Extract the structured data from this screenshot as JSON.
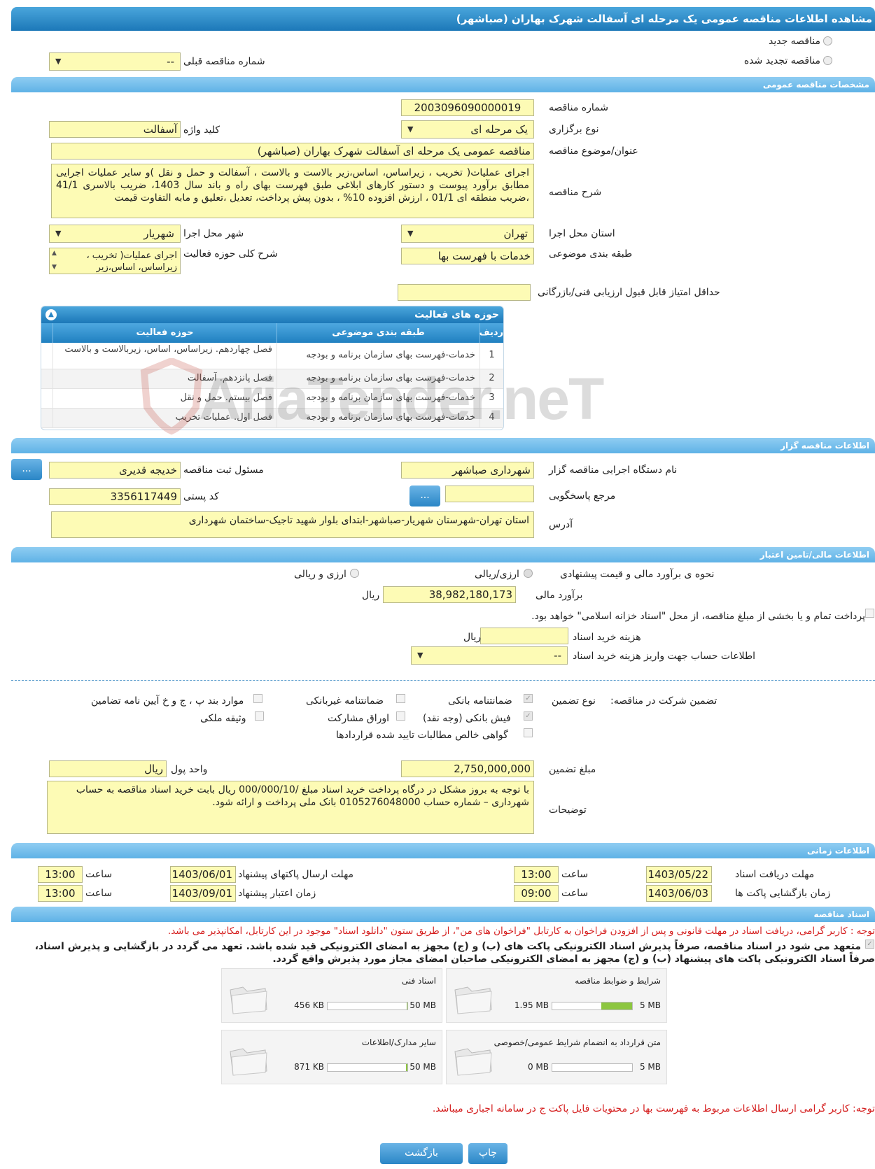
{
  "title": "مشاهده اطلاعات مناقصه عمومی یک مرحله ای آسفالت شهرک بهاران (صباشهر)",
  "top": {
    "new_tender": "مناقصه جدید",
    "renewed_tender": "مناقصه تجدید شده",
    "prev_number_label": "شماره مناقصه قبلی",
    "prev_number_value": "--"
  },
  "general": {
    "section": "مشخصات مناقصه عمومی",
    "tender_number_label": "شماره مناقصه",
    "tender_number": "2003096090000019",
    "type_label": "نوع برگزاری",
    "type_value": "یک مرحله ای",
    "keyword_label": "کلید واژه",
    "keyword_value": "آسفالت",
    "subject_label": "عنوان/موضوع مناقصه",
    "subject_value": "مناقصه عمومی یک مرحله ای آسفالت شهرک بهاران (صباشهر)",
    "desc_label": "شرح مناقصه",
    "desc_value": "اجرای عملیات( تخریب ، زیراساس، اساس،زیر بالاست و بالاست ، آسفالت و حمل و نقل )و سایر عملیات اجرایی مطابق برآورد پیوست و دستور کارهای ابلاغی طبق فهرست بهای راه و باند سال 1403، ضریب بالاسری 41/1 ،ضریب منطقه ای 01/1 ، ارزش افزوده 10% ، بدون پیش پرداخت، تعدیل ،تعلیق و مابه التفاوت قیمت",
    "province_label": "استان محل اجرا",
    "province_value": "تهران",
    "city_label": "شهر محل اجرا",
    "city_value": "شهریار",
    "category_label": "طبقه بندی موضوعی",
    "category_value": "خدمات با فهرست بها",
    "activity_desc_label": "شرح کلی حوزه فعالیت",
    "activity_desc_value": "اجرای عملیات( تخریب ، زیراساس، اساس،زیر",
    "min_score_label": "حداقل امتیاز قابل قبول ارزیابی فنی/بازرگانی",
    "min_score_value": ""
  },
  "activities": {
    "title": "حوزه های فعالیت",
    "col_row": "ردیف",
    "col_category": "طبقه بندی موضوعی",
    "col_field": "حوزه فعالیت",
    "rows": [
      {
        "n": "1",
        "category": "خدمات-فهرست بهای سازمان برنامه و بودجه",
        "field": "فصل چهاردهم. زیراساس، اساس، زیربالاست  و بالاست"
      },
      {
        "n": "2",
        "category": "خدمات-فهرست بهای سازمان برنامه و بودجه",
        "field": "فصل پانزدهم. آسفالت"
      },
      {
        "n": "3",
        "category": "خدمات-فهرست بهای سازمان برنامه و بودجه",
        "field": "فصل بیستم. حمل و نقل"
      },
      {
        "n": "4",
        "category": "خدمات-فهرست بهای سازمان برنامه و بودجه",
        "field": "فصل اول. عملیات تخریب"
      }
    ]
  },
  "organizer": {
    "section": "اطلاعات مناقصه گزار",
    "org_label": "نام دستگاه اجرایی مناقصه گزار",
    "org_value": "شهرداری صباشهر",
    "resp_label": "مسئول ثبت مناقصه",
    "resp_value": "خدیجه قدیری",
    "ref_label": "مرجع پاسخگویی",
    "ref_value": "",
    "postal_label": "کد پستی",
    "postal_value": "3356117449",
    "address_label": "آدرس",
    "address_value": "استان تهران-شهرستان شهریار-صباشهر-ابتدای بلوار شهید تاجیک-ساختمان شهرداری",
    "more": "..."
  },
  "finance": {
    "section": "اطلاعات مالی/تامین اعتبار",
    "method_label": "نحوه ی برآورد مالی و قیمت پیشنهادی",
    "opt_rial": "ارزی/ریالی",
    "opt_fx": "ارزی و ریالی",
    "estimate_label": "برآورد مالی",
    "estimate_value": "38,982,180,173",
    "rial": "ریال",
    "treasury_text": "پرداخت تمام و یا بخشی از مبلغ مناقصه، از محل \"اسناد خزانه اسلامی\" خواهد بود.",
    "doc_fee_label": "هزینه خرید اسناد",
    "doc_fee_value": "",
    "doc_fee_unit": "ریال",
    "account_label": "اطلاعات حساب جهت واریز هزینه خرید اسناد",
    "account_value": "--"
  },
  "guarantee": {
    "label": "تضمین شرکت در مناقصه:",
    "type_label": "نوع تضمین",
    "bank_guarantee": "ضمانتنامه بانکی",
    "nonbank_guarantee": "ضمانتنامه غیربانکی",
    "items_bpc": "موارد بند پ ، ج و خ آیین نامه تضامین",
    "bank_receipt": "فیش بانکی (وجه نقد)",
    "bonds": "اوراق مشارکت",
    "property": "وثیقه ملکی",
    "claims": "گواهی خالص مطالبات تایید شده قراردادها",
    "amount_label": "مبلغ تضمین",
    "amount_value": "2,750,000,000",
    "currency_label": "واحد پول",
    "currency_value": "ریال",
    "notes_label": "توضیحات",
    "notes_value": "با توجه به بروز مشکل در درگاه پرداخت خرید اسناد مبلغ /000/000/10 ریال بابت خرید اسناد مناقصه به حساب شهرداری – شماره حساب 0105276048000   بانک ملی پرداخت و ارائه شود."
  },
  "timing": {
    "section": "اطلاعات زمانی",
    "receive_label": "مهلت دریافت اسناد",
    "receive_date": "1403/05/22",
    "receive_time": "13:00",
    "send_label": "مهلت ارسال پاکتهای پیشنهاد",
    "send_date": "1403/06/01",
    "send_time": "13:00",
    "open_label": "زمان بازگشایی پاکت ها",
    "open_date": "1403/06/03",
    "open_time": "09:00",
    "validity_label": "زمان اعتبار پیشنهاد",
    "validity_date": "1403/09/01",
    "validity_time": "13:00",
    "time_label": "ساعت"
  },
  "docs": {
    "section": "اسناد مناقصه",
    "note1": "توجه : کاربر گرامی، دریافت اسناد در مهلت قانونی و پس از افزودن فراخوان به کارتابل \"فراخوان های من\"، از طریق ستون \"دانلود اسناد\" موجود در این کارتابل، امکانپذیر می باشد.",
    "commit": "متعهد می شود در اسناد مناقصه، صرفاً پذیرش اسناد الکترونیکی پاکت های (ب) و (ج) مجهز به امضای الکترونیکی قید شده باشد. تعهد می گردد در بازگشایی و پذیرش اسناد، صرفاً اسناد الکترونیکی پاکت های پیشنهاد (ب) و (ج) مجهز به امضای الکترونیکی صاحبان امضای مجاز مورد پذیرش واقع گردد.",
    "files": [
      {
        "name": "شرایط و ضوابط مناقصه",
        "current": "1.95 MB",
        "max": "5 MB",
        "fill": 0.39
      },
      {
        "name": "اسناد فنی",
        "current": "456 KB",
        "max": "50 MB",
        "fill": 0.01
      },
      {
        "name": "متن قرارداد به انضمام شرایط عمومی/خصوصی",
        "current": "0 MB",
        "max": "5 MB",
        "fill": 0
      },
      {
        "name": "سایر مدارک/اطلاعات",
        "current": "871 KB",
        "max": "50 MB",
        "fill": 0.02
      }
    ],
    "note2": "توجه: کاربر گرامی ارسال اطلاعات مربوط به فهرست بها در محتویات فایل پاکت ج در سامانه اجباری میباشد."
  },
  "buttons": {
    "print": "چاپ",
    "back": "بازگشت"
  },
  "watermark": "AriaTender.neT"
}
